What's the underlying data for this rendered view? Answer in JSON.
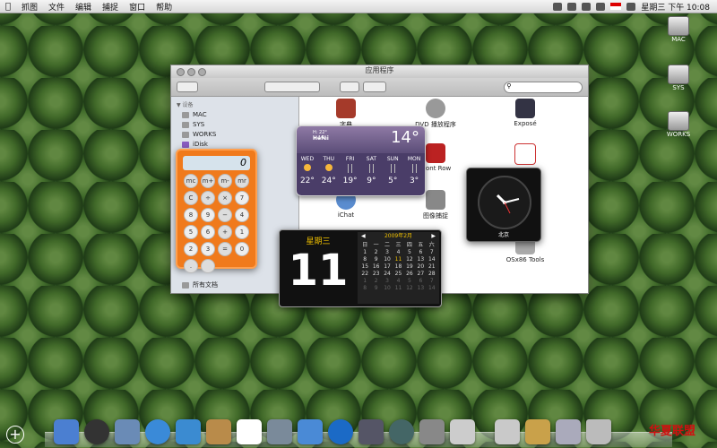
{
  "menubar": {
    "items": [
      "抓图",
      "文件",
      "编辑",
      "捕捉",
      "窗口",
      "帮助"
    ],
    "clock": "星期三 下午 10:08"
  },
  "desktop": {
    "drives": [
      "MAC",
      "SYS",
      "WORKS"
    ]
  },
  "finder": {
    "title": "应用程序",
    "sidebar_header": "▼ 设备",
    "sidebar_items": [
      "MAC",
      "SYS",
      "WORKS",
      "iDisk"
    ],
    "sidebar_bottom": "所有文档",
    "apps": [
      "字典",
      "DVD 播放程序",
      "Exposé",
      "Front Row",
      "iChat",
      "图像捕捉",
      "OSx86 Tools"
    ]
  },
  "weather": {
    "hilo": [
      "H: 22°",
      "L: 14°"
    ],
    "city": "Hefei",
    "temp": "14°",
    "days": [
      {
        "d": "WED",
        "t": "22°",
        "icon": "sun"
      },
      {
        "d": "THU",
        "t": "24°",
        "icon": "sun"
      },
      {
        "d": "FRI",
        "t": "19°",
        "icon": "rain"
      },
      {
        "d": "SAT",
        "t": "9°",
        "icon": "rain"
      },
      {
        "d": "SUN",
        "t": "5°",
        "icon": "snow"
      },
      {
        "d": "MON",
        "t": "3°",
        "icon": "rain"
      }
    ]
  },
  "calculator": {
    "display": "0",
    "keys": [
      "mc",
      "m+",
      "m-",
      "mr",
      "C",
      "÷",
      "×",
      "7",
      "8",
      "9",
      "−",
      "4",
      "5",
      "6",
      "+",
      "1",
      "2",
      "3",
      "=",
      "0",
      ".",
      ""
    ]
  },
  "worldclock": {
    "city": "北京"
  },
  "calendar": {
    "weekday": "星期三",
    "day": "11",
    "month": "2009年2月",
    "headers": [
      "日",
      "一",
      "二",
      "三",
      "四",
      "五",
      "六"
    ],
    "cells": [
      "1",
      "2",
      "3",
      "4",
      "5",
      "6",
      "7",
      "8",
      "9",
      "10",
      "11",
      "12",
      "13",
      "14",
      "15",
      "16",
      "17",
      "18",
      "19",
      "20",
      "21",
      "22",
      "23",
      "24",
      "25",
      "26",
      "27",
      "28",
      "1",
      "2",
      "3",
      "4",
      "5",
      "6",
      "7",
      "8",
      "9",
      "10",
      "11",
      "12",
      "13",
      "14"
    ],
    "today_index": 10
  },
  "brand": "华夏联盟"
}
